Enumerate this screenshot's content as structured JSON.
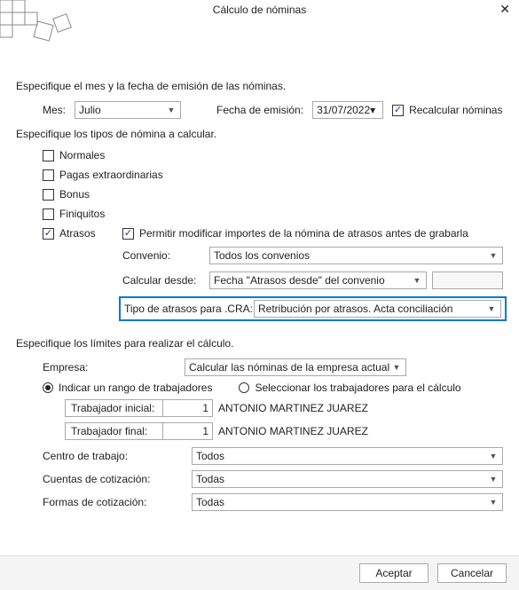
{
  "window": {
    "title": "Cálculo de nóminas"
  },
  "section1": {
    "label": "Especifique el mes y la fecha de emisión de las nóminas.",
    "mes_label": "Mes:",
    "mes_value": "Julio",
    "fecha_label": "Fecha de emisión:",
    "fecha_value": "31/07/2022",
    "recalc_label": "Recalcular nóminas"
  },
  "section2": {
    "label": "Especifique los tipos de nómina a calcular.",
    "tipos": {
      "normales": "Normales",
      "pagas": "Pagas extraordinarias",
      "bonus": "Bonus",
      "finiquitos": "Finiquitos",
      "atrasos": "Atrasos"
    },
    "permitir": "Permitir modificar importes de la nómina de atrasos antes de grabarla",
    "convenio_label": "Convenio:",
    "convenio_value": "Todos los convenios",
    "calcdesde_label": "Calcular desde:",
    "calcdesde_value": "Fecha \"Atrasos desde\" del convenio",
    "tipo_atrasos_label": "Tipo de atrasos para .CRA:",
    "tipo_atrasos_value": "Retribución por atrasos. Acta conciliación"
  },
  "section3": {
    "label": "Especifique los límites para realizar el cálculo.",
    "empresa_label": "Empresa:",
    "empresa_value": "Calcular las nóminas de la empresa actual",
    "radio_rango": "Indicar un rango de trabajadores",
    "radio_sel": "Seleccionar los trabajadores para el cálculo",
    "trab_ini_label": "Trabajador inicial:",
    "trab_ini_num": "1",
    "trab_ini_name": "ANTONIO MARTINEZ JUAREZ",
    "trab_fin_label": "Trabajador final:",
    "trab_fin_num": "1",
    "trab_fin_name": "ANTONIO MARTINEZ JUAREZ",
    "centro_label": "Centro de trabajo:",
    "centro_value": "Todos",
    "cuentas_label": "Cuentas de cotización:",
    "cuentas_value": "Todas",
    "formas_label": "Formas de cotización:",
    "formas_value": "Todas"
  },
  "footer": {
    "aceptar": "Aceptar",
    "cancelar": "Cancelar"
  }
}
